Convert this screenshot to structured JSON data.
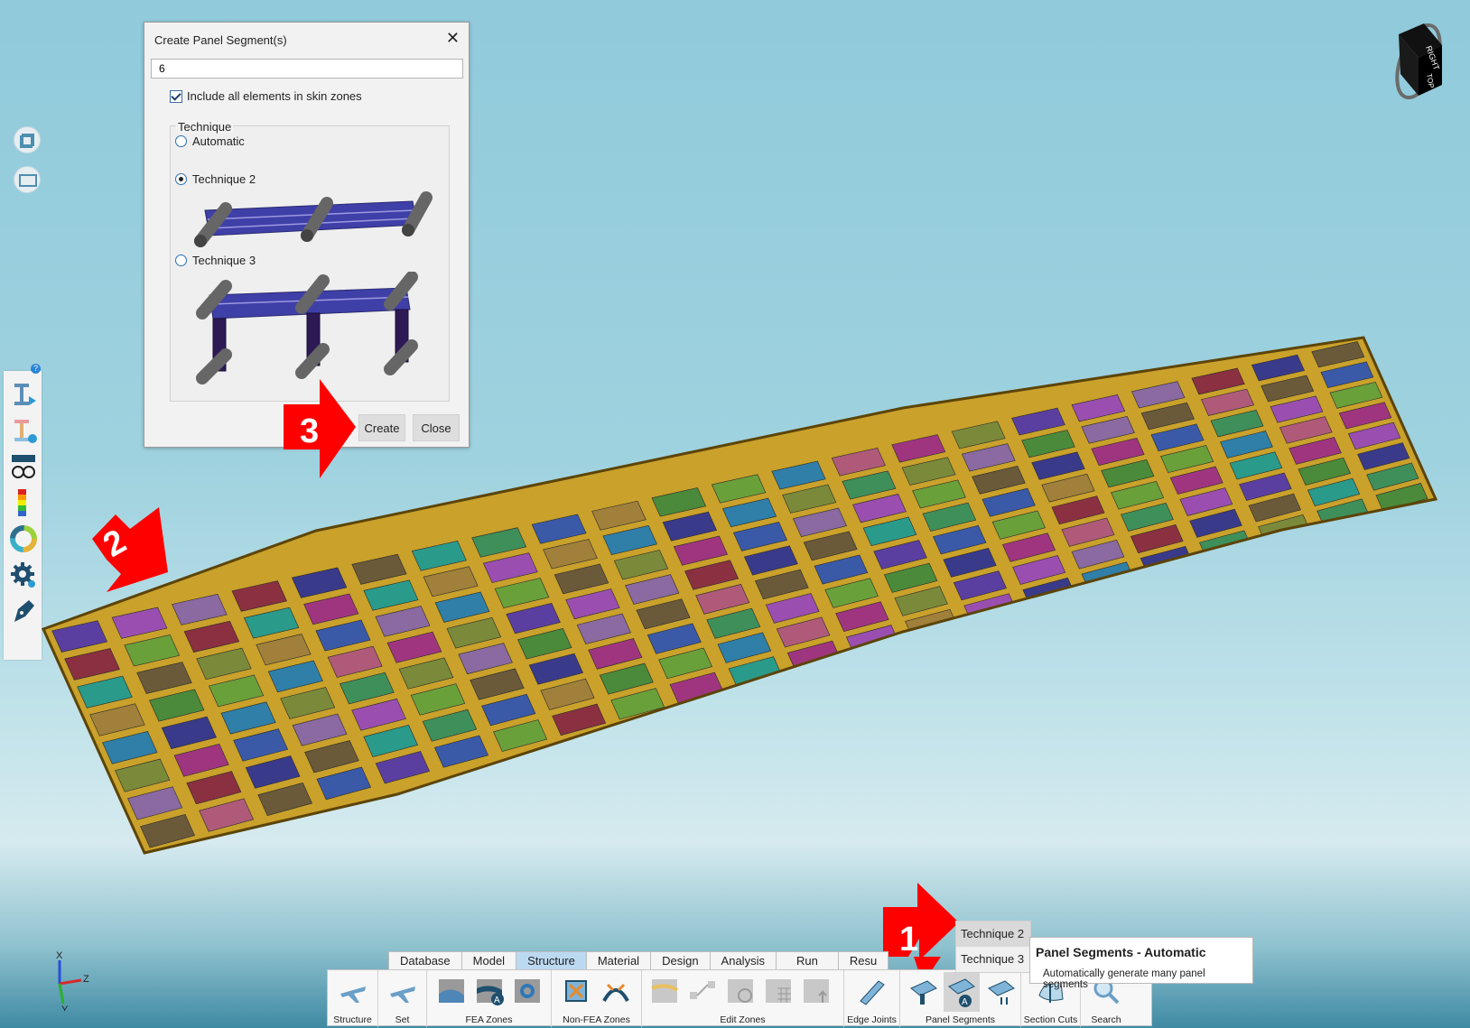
{
  "dialog": {
    "title": "Create Panel Segment(s)",
    "name_value": "6",
    "include_all_label": "Include all elements in skin zones",
    "include_all_checked": true,
    "technique_group_label": "Technique",
    "options": [
      {
        "label": "Automatic",
        "selected": false
      },
      {
        "label": "Technique 2",
        "selected": true
      },
      {
        "label": "Technique 3",
        "selected": false
      }
    ],
    "create_label": "Create",
    "close_label": "Close"
  },
  "markers": {
    "one": "1",
    "two": "2",
    "three": "3"
  },
  "view_cube": {
    "face_right": "RIGHT",
    "face_top": "TOP"
  },
  "axes": {
    "x": "X",
    "y": "Y",
    "z": "Z"
  },
  "left_toolbar": {
    "help": "?"
  },
  "ribbon": {
    "tabs": [
      "Database",
      "Model",
      "Structure",
      "Material",
      "Design",
      "Analysis",
      "Run",
      "Resu"
    ],
    "active_tab": "Structure",
    "groups": {
      "structure": "Structure",
      "set": "Set",
      "fea_zones": "FEA Zones",
      "non_fea_zones": "Non-FEA Zones",
      "edit_zones": "Edit Zones",
      "edge_joints": "Edge Joints",
      "panel_segments": "Panel Segments",
      "section_cuts": "Section Cuts",
      "search": "Search"
    },
    "badge": "A"
  },
  "popup": {
    "items": [
      "Technique 2",
      "Technique 3"
    ]
  },
  "tooltip": {
    "title": "Panel Segments - Automatic",
    "description": "Automatically generate many panel segments"
  },
  "colors": {
    "frame": "#c9a12b",
    "accent_tab": "#bcd9f2",
    "marker_red": "#ff0000"
  }
}
